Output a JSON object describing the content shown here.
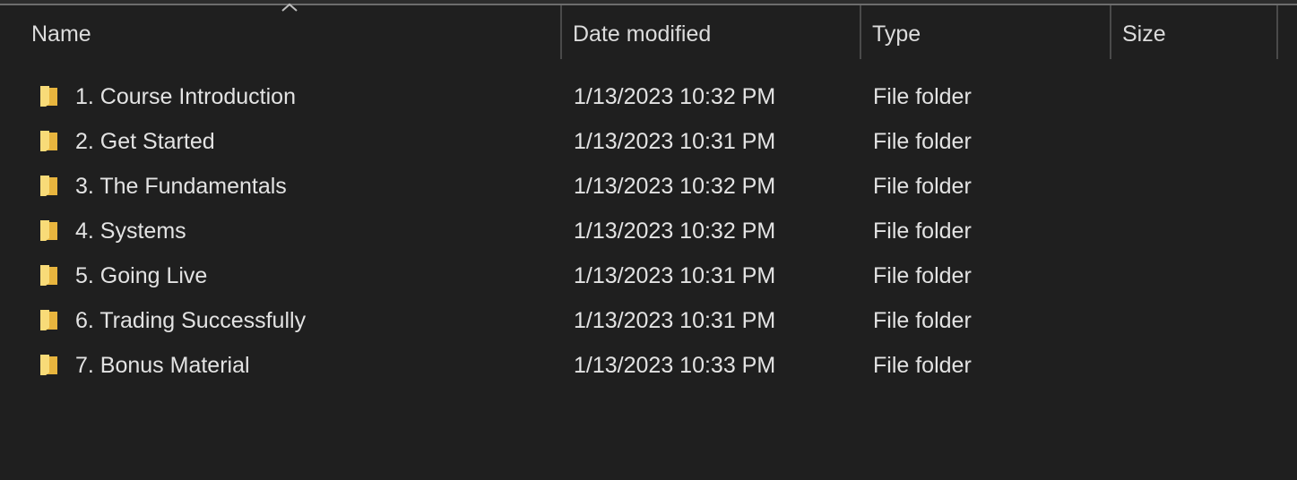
{
  "columns": {
    "name": "Name",
    "date_modified": "Date modified",
    "type": "Type",
    "size": "Size",
    "sorted_by": "name",
    "sort_icon": "chevron-up-icon"
  },
  "colors": {
    "background": "#1f1f1f",
    "text": "#e3e3e3",
    "folder_icon": "#f2c94c"
  },
  "files": [
    {
      "name": "1. Course Introduction",
      "date_modified": "1/13/2023 10:32 PM",
      "type": "File folder",
      "size": "",
      "icon": "folder-icon"
    },
    {
      "name": "2. Get Started",
      "date_modified": "1/13/2023 10:31 PM",
      "type": "File folder",
      "size": "",
      "icon": "folder-icon"
    },
    {
      "name": "3. The Fundamentals",
      "date_modified": "1/13/2023 10:32 PM",
      "type": "File folder",
      "size": "",
      "icon": "folder-icon"
    },
    {
      "name": "4. Systems",
      "date_modified": "1/13/2023 10:32 PM",
      "type": "File folder",
      "size": "",
      "icon": "folder-icon"
    },
    {
      "name": "5. Going Live",
      "date_modified": "1/13/2023 10:31 PM",
      "type": "File folder",
      "size": "",
      "icon": "folder-icon"
    },
    {
      "name": "6. Trading Successfully",
      "date_modified": "1/13/2023 10:31 PM",
      "type": "File folder",
      "size": "",
      "icon": "folder-icon"
    },
    {
      "name": "7. Bonus Material",
      "date_modified": "1/13/2023 10:33 PM",
      "type": "File folder",
      "size": "",
      "icon": "folder-icon"
    }
  ]
}
